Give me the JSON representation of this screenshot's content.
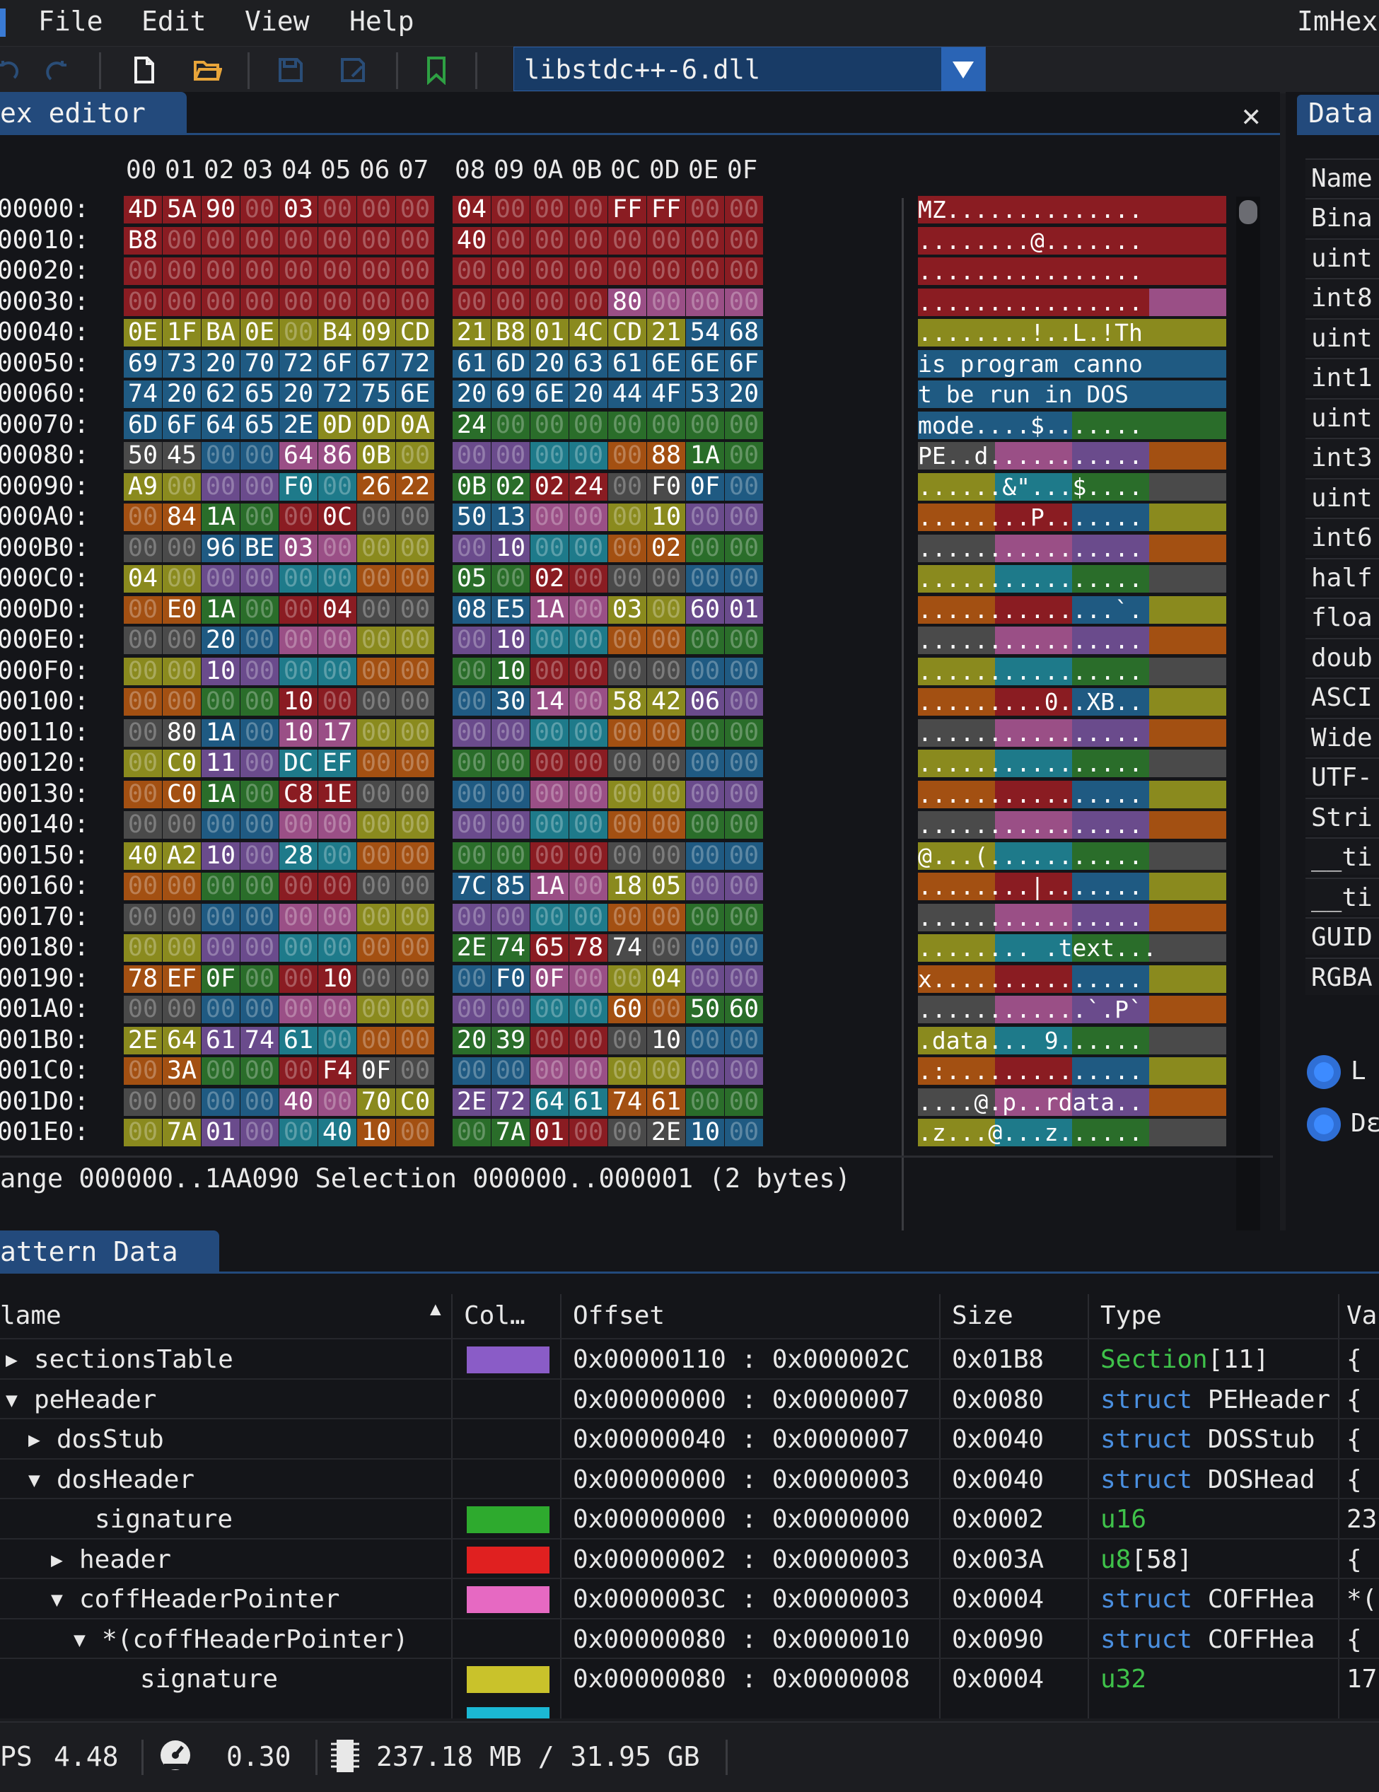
{
  "menu": {
    "items": [
      "File",
      "Edit",
      "View",
      "Help"
    ],
    "app_title": "ImHex"
  },
  "toolbar": {
    "icons": [
      "undo-icon",
      "redo-icon",
      "new-file-icon",
      "open-file-icon",
      "save-icon",
      "save-as-icon",
      "bookmark-icon"
    ],
    "file_select": "libstdc++-6.dll"
  },
  "hex_editor": {
    "tab_label": "ex editor",
    "column_header": [
      "00",
      "01",
      "02",
      "03",
      "04",
      "05",
      "06",
      "07",
      "08",
      "09",
      "0A",
      "0B",
      "0C",
      "0D",
      "0E",
      "0F"
    ],
    "rows": [
      {
        "addr": "00000:",
        "bytes": [
          "4D",
          "5A",
          "90",
          "00",
          "03",
          "00",
          "00",
          "00",
          "04",
          "00",
          "00",
          "00",
          "FF",
          "FF",
          "00",
          "00"
        ],
        "ascii": "MZ.............."
      },
      {
        "addr": "00010:",
        "bytes": [
          "B8",
          "00",
          "00",
          "00",
          "00",
          "00",
          "00",
          "00",
          "40",
          "00",
          "00",
          "00",
          "00",
          "00",
          "00",
          "00"
        ],
        "ascii": "........@......."
      },
      {
        "addr": "00020:",
        "bytes": [
          "00",
          "00",
          "00",
          "00",
          "00",
          "00",
          "00",
          "00",
          "00",
          "00",
          "00",
          "00",
          "00",
          "00",
          "00",
          "00"
        ],
        "ascii": "................"
      },
      {
        "addr": "00030:",
        "bytes": [
          "00",
          "00",
          "00",
          "00",
          "00",
          "00",
          "00",
          "00",
          "00",
          "00",
          "00",
          "00",
          "80",
          "00",
          "00",
          "00"
        ],
        "ascii": "................"
      },
      {
        "addr": "00040:",
        "bytes": [
          "0E",
          "1F",
          "BA",
          "0E",
          "00",
          "B4",
          "09",
          "CD",
          "21",
          "B8",
          "01",
          "4C",
          "CD",
          "21",
          "54",
          "68"
        ],
        "ascii": "........!..L.!Th"
      },
      {
        "addr": "00050:",
        "bytes": [
          "69",
          "73",
          "20",
          "70",
          "72",
          "6F",
          "67",
          "72",
          "61",
          "6D",
          "20",
          "63",
          "61",
          "6E",
          "6E",
          "6F"
        ],
        "ascii": "is program canno"
      },
      {
        "addr": "00060:",
        "bytes": [
          "74",
          "20",
          "62",
          "65",
          "20",
          "72",
          "75",
          "6E",
          "20",
          "69",
          "6E",
          "20",
          "44",
          "4F",
          "53",
          "20"
        ],
        "ascii": "t be run in DOS "
      },
      {
        "addr": "00070:",
        "bytes": [
          "6D",
          "6F",
          "64",
          "65",
          "2E",
          "0D",
          "0D",
          "0A",
          "24",
          "00",
          "00",
          "00",
          "00",
          "00",
          "00",
          "00"
        ],
        "ascii": "mode....$......."
      },
      {
        "addr": "00080:",
        "bytes": [
          "50",
          "45",
          "00",
          "00",
          "64",
          "86",
          "0B",
          "00",
          "00",
          "00",
          "00",
          "00",
          "00",
          "88",
          "1A",
          "00"
        ],
        "ascii": "PE..d..........."
      },
      {
        "addr": "00090:",
        "bytes": [
          "A9",
          "00",
          "00",
          "00",
          "F0",
          "00",
          "26",
          "22",
          "0B",
          "02",
          "02",
          "24",
          "00",
          "F0",
          "0F",
          "00"
        ],
        "ascii": "......&\"...$...."
      },
      {
        "addr": "000A0:",
        "bytes": [
          "00",
          "84",
          "1A",
          "00",
          "00",
          "0C",
          "00",
          "00",
          "50",
          "13",
          "00",
          "00",
          "00",
          "10",
          "00",
          "00"
        ],
        "ascii": "........P......."
      },
      {
        "addr": "000B0:",
        "bytes": [
          "00",
          "00",
          "96",
          "BE",
          "03",
          "00",
          "00",
          "00",
          "00",
          "10",
          "00",
          "00",
          "00",
          "02",
          "00",
          "00"
        ],
        "ascii": "................"
      },
      {
        "addr": "000C0:",
        "bytes": [
          "04",
          "00",
          "00",
          "00",
          "00",
          "00",
          "00",
          "00",
          "05",
          "00",
          "02",
          "00",
          "00",
          "00",
          "00",
          "00"
        ],
        "ascii": "................"
      },
      {
        "addr": "000D0:",
        "bytes": [
          "00",
          "E0",
          "1A",
          "00",
          "00",
          "04",
          "00",
          "00",
          "08",
          "E5",
          "1A",
          "00",
          "03",
          "00",
          "60",
          "01"
        ],
        "ascii": "..............`."
      },
      {
        "addr": "000E0:",
        "bytes": [
          "00",
          "00",
          "20",
          "00",
          "00",
          "00",
          "00",
          "00",
          "00",
          "10",
          "00",
          "00",
          "00",
          "00",
          "00",
          "00"
        ],
        "ascii": "................"
      },
      {
        "addr": "000F0:",
        "bytes": [
          "00",
          "00",
          "10",
          "00",
          "00",
          "00",
          "00",
          "00",
          "00",
          "10",
          "00",
          "00",
          "00",
          "00",
          "00",
          "00"
        ],
        "ascii": "................"
      },
      {
        "addr": "00100:",
        "bytes": [
          "00",
          "00",
          "00",
          "00",
          "10",
          "00",
          "00",
          "00",
          "00",
          "30",
          "14",
          "00",
          "58",
          "42",
          "06",
          "00"
        ],
        "ascii": ".........0..XB.."
      },
      {
        "addr": "00110:",
        "bytes": [
          "00",
          "80",
          "1A",
          "00",
          "10",
          "17",
          "00",
          "00",
          "00",
          "00",
          "00",
          "00",
          "00",
          "00",
          "00",
          "00"
        ],
        "ascii": "................"
      },
      {
        "addr": "00120:",
        "bytes": [
          "00",
          "C0",
          "11",
          "00",
          "DC",
          "EF",
          "00",
          "00",
          "00",
          "00",
          "00",
          "00",
          "00",
          "00",
          "00",
          "00"
        ],
        "ascii": "................"
      },
      {
        "addr": "00130:",
        "bytes": [
          "00",
          "C0",
          "1A",
          "00",
          "C8",
          "1E",
          "00",
          "00",
          "00",
          "00",
          "00",
          "00",
          "00",
          "00",
          "00",
          "00"
        ],
        "ascii": "................"
      },
      {
        "addr": "00140:",
        "bytes": [
          "00",
          "00",
          "00",
          "00",
          "00",
          "00",
          "00",
          "00",
          "00",
          "00",
          "00",
          "00",
          "00",
          "00",
          "00",
          "00"
        ],
        "ascii": "................"
      },
      {
        "addr": "00150:",
        "bytes": [
          "40",
          "A2",
          "10",
          "00",
          "28",
          "00",
          "00",
          "00",
          "00",
          "00",
          "00",
          "00",
          "00",
          "00",
          "00",
          "00"
        ],
        "ascii": "@...(..........."
      },
      {
        "addr": "00160:",
        "bytes": [
          "00",
          "00",
          "00",
          "00",
          "00",
          "00",
          "00",
          "00",
          "7C",
          "85",
          "1A",
          "00",
          "18",
          "05",
          "00",
          "00"
        ],
        "ascii": "........|......."
      },
      {
        "addr": "00170:",
        "bytes": [
          "00",
          "00",
          "00",
          "00",
          "00",
          "00",
          "00",
          "00",
          "00",
          "00",
          "00",
          "00",
          "00",
          "00",
          "00",
          "00"
        ],
        "ascii": "................"
      },
      {
        "addr": "00180:",
        "bytes": [
          "00",
          "00",
          "00",
          "00",
          "00",
          "00",
          "00",
          "00",
          "2E",
          "74",
          "65",
          "78",
          "74",
          "00",
          "00",
          "00"
        ],
        "ascii": "........ .text..."
      },
      {
        "addr": "00190:",
        "bytes": [
          "78",
          "EF",
          "0F",
          "00",
          "00",
          "10",
          "00",
          "00",
          "00",
          "F0",
          "0F",
          "00",
          "00",
          "04",
          "00",
          "00"
        ],
        "ascii": "x..............."
      },
      {
        "addr": "001A0:",
        "bytes": [
          "00",
          "00",
          "00",
          "00",
          "00",
          "00",
          "00",
          "00",
          "00",
          "00",
          "00",
          "00",
          "60",
          "00",
          "50",
          "60"
        ],
        "ascii": "............`.P`"
      },
      {
        "addr": "001B0:",
        "bytes": [
          "2E",
          "64",
          "61",
          "74",
          "61",
          "00",
          "00",
          "00",
          "20",
          "39",
          "00",
          "00",
          "00",
          "10",
          "00",
          "00"
        ],
        "ascii": ".data... 9......"
      },
      {
        "addr": "001C0:",
        "bytes": [
          "00",
          "3A",
          "00",
          "00",
          "00",
          "F4",
          "0F",
          "00",
          "00",
          "00",
          "00",
          "00",
          "00",
          "00",
          "00",
          "00"
        ],
        "ascii": ".:.............."
      },
      {
        "addr": "001D0:",
        "bytes": [
          "00",
          "00",
          "00",
          "00",
          "40",
          "00",
          "70",
          "C0",
          "2E",
          "72",
          "64",
          "61",
          "74",
          "61",
          "00",
          "00"
        ],
        "ascii": "....@.p..rdata.."
      },
      {
        "addr": "001E0:",
        "bytes": [
          "00",
          "7A",
          "01",
          "00",
          "00",
          "40",
          "10",
          "00",
          "00",
          "7A",
          "01",
          "00",
          "00",
          "2E",
          "10",
          "00"
        ],
        "ascii": ".z...@...z......"
      }
    ],
    "status": "ange 000000..1AA090   Selection 000000..000001 (2 bytes)"
  },
  "data_inspector": {
    "tab_label": "Data",
    "header": "Name",
    "rows": [
      "Bina",
      "uint",
      "int8",
      "uint",
      "int1",
      "uint",
      "int3",
      "uint",
      "int6",
      "half",
      "floa",
      "doub",
      "ASCI",
      "Wide",
      "UTF-",
      "Stri",
      "__ti",
      "__ti",
      "GUID",
      "RGBA"
    ],
    "radio_labels": [
      "L",
      "Dε"
    ]
  },
  "pattern_data": {
    "tab_label": "attern Data",
    "columns": [
      "lame",
      "Col…",
      "Offset",
      "Size",
      "Type",
      "Va"
    ],
    "rows": [
      {
        "expander": "▶",
        "name": "sectionsTable",
        "color": "#8a5cc7",
        "offset": "0x00000110 : 0x000002C",
        "size": "0x01B8",
        "type_a": "Section",
        "type_b": "[11]",
        "value": "{"
      },
      {
        "expander": "▼",
        "name": "peHeader",
        "color": "",
        "offset": "0x00000000 : 0x0000007",
        "size": "0x0080",
        "type_a": "struct",
        "type_b": "PEHeader",
        "value": "{"
      },
      {
        "expander": "▶",
        "name": "dosStub",
        "color": "",
        "offset": "0x00000040 : 0x0000007",
        "size": "0x0040",
        "type_a": "struct",
        "type_b": "DOSStub",
        "value": "{"
      },
      {
        "expander": "▼",
        "name": "dosHeader",
        "color": "",
        "offset": "0x00000000 : 0x0000003",
        "size": "0x0040",
        "type_a": "struct",
        "type_b": "DOSHead",
        "value": "{"
      },
      {
        "expander": "",
        "name": "signature",
        "color": "#2eaa2e",
        "offset": "0x00000000 : 0x0000000",
        "size": "0x0002",
        "type_a": "u16",
        "type_b": "",
        "value": "23"
      },
      {
        "expander": "▶",
        "name": "header",
        "color": "#e02020",
        "offset": "0x00000002 : 0x0000003",
        "size": "0x003A",
        "type_a": "u8",
        "type_b": "[58]",
        "value": "{"
      },
      {
        "expander": "▼",
        "name": "coffHeaderPointer",
        "color": "#e669c2",
        "offset": "0x0000003C : 0x0000003",
        "size": "0x0004",
        "type_a": "struct",
        "type_b": "COFFHea",
        "value": "*("
      },
      {
        "expander": "▼",
        "name": "*(coffHeaderPointer)",
        "color": "",
        "offset": "0x00000080 : 0x0000010",
        "size": "0x0090",
        "type_a": "struct",
        "type_b": "COFFHea",
        "value": "{"
      },
      {
        "expander": "",
        "name": "signature",
        "color": "#c9c22b",
        "offset": "0x00000080 : 0x0000008",
        "size": "0x0004",
        "type_a": "u32",
        "type_b": "",
        "value": "17"
      }
    ]
  },
  "statusbar": {
    "fps_label": "PS",
    "fps": "4.48",
    "cpu": "0.30",
    "memory": "237.18 MB / 31.95 GB"
  },
  "colors": {
    "accent": "#234a7c",
    "dos_header": "#8a1c22",
    "dos_stub": "#1f5a82",
    "pe_yellow": "#8a8a1e",
    "green": "#2a6d2a",
    "purple": "#6a4b8c",
    "orange": "#a35012",
    "teal": "#1e7a8a",
    "grey": "#4a4a4a",
    "pink": "#9a4f86"
  }
}
